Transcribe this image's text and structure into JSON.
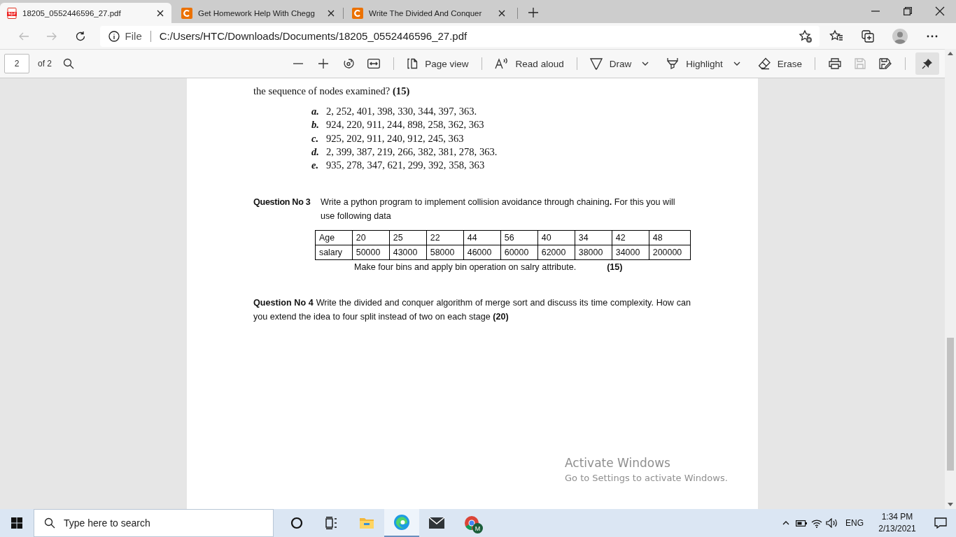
{
  "tabs": [
    {
      "title": "18205_0552446596_27.pdf",
      "kind": "pdf",
      "selected": true
    },
    {
      "title": "Get Homework Help With Chegg",
      "kind": "chegg",
      "selected": false
    },
    {
      "title": "Write The Divided And Conquer",
      "kind": "chegg",
      "selected": false
    }
  ],
  "address_bar": {
    "scheme": "File",
    "url": "C:/Users/HTC/Downloads/Documents/18205_0552446596_27.pdf"
  },
  "pdf_toolbar": {
    "page_number": "2",
    "page_count": "of 2",
    "tools": [
      {
        "kind": "page-view",
        "label": "Page view",
        "menu": false
      },
      {
        "kind": "read-aloud",
        "label": "Read aloud",
        "menu": false
      },
      {
        "kind": "draw",
        "label": "Draw",
        "menu": true
      },
      {
        "kind": "highlight",
        "label": "Highlight",
        "menu": true
      },
      {
        "kind": "erase",
        "label": "Erase",
        "menu": false
      }
    ],
    "icon_buttons": [
      {
        "kind": "print",
        "disabled": false
      },
      {
        "kind": "save",
        "disabled": true
      },
      {
        "kind": "save-as",
        "disabled": false
      }
    ],
    "pinned": true
  },
  "document": {
    "question_2_tail": "the sequence of nodes examined? **(15)**",
    "options": [
      {
        "letter": "a.",
        "text": "2, 252, 401, 398, 330, 344, 397, 363."
      },
      {
        "letter": "b.",
        "text": "924, 220, 911, 244, 898, 258, 362, 363"
      },
      {
        "letter": "c.",
        "text": "925, 202, 911, 240, 912, 245, 363"
      },
      {
        "letter": "d.",
        "text": "2, 399, 387, 219, 266, 382, 381, 278, 363."
      },
      {
        "letter": "e.",
        "text": "935, 278, 347, 621, 299, 392, 358, 363"
      }
    ],
    "question_3": {
      "label": "Question No 3",
      "text": "Write a python program to implement collision avoidance  through chaining**.** For this you will use following data",
      "table": [
        [
          "Age",
          "20",
          "25",
          "22",
          "44",
          "56",
          "40",
          "34",
          "42",
          "48"
        ],
        [
          "salary",
          "50000",
          "43000",
          "58000",
          "46000",
          "60000",
          "62000",
          "38000",
          "34000",
          "200000"
        ]
      ],
      "note": "Make four bins and apply bin operation on salry attribute.",
      "marks": "(15)"
    },
    "question_4": "**Question No 4** Write the divided and conquer algorithm of merge sort and discuss its time complexity. How can you extend the idea to four split instead of two on each stage **(20)**"
  },
  "activation_notice": {
    "title": "Activate Windows",
    "subtitle": "Go to Settings to activate Windows."
  },
  "taskbar": {
    "search_placeholder": "Type here to search",
    "apps": [
      {
        "kind": "cortana",
        "active": false
      },
      {
        "kind": "task-view",
        "active": false
      },
      {
        "kind": "explorer",
        "active": false
      },
      {
        "kind": "edge",
        "active": true
      },
      {
        "kind": "mail",
        "active": false
      },
      {
        "kind": "chrome",
        "active": false,
        "badge": "M"
      }
    ],
    "language": "ENG",
    "time": "1:34 PM",
    "date": "2/13/2021"
  }
}
